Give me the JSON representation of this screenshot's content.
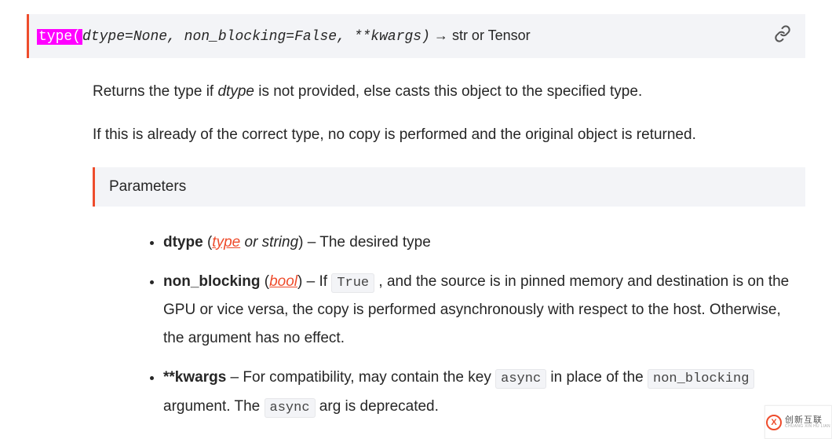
{
  "signature": {
    "method_name": "type",
    "open_paren": "(",
    "args": "dtype=None, non_blocking=False, **kwargs",
    "close_paren": ")",
    "arrow": " → ",
    "return_type": "str or Tensor"
  },
  "description": {
    "p1_a": "Returns the type if ",
    "p1_em": "dtype",
    "p1_b": " is not provided, else casts this object to the specified type.",
    "p2": "If this is already of the correct type, no copy is performed and the original object is returned."
  },
  "params_header": "Parameters",
  "params": {
    "dtype": {
      "name": "dtype",
      "open": " (",
      "type_link": "type",
      "or": " or ",
      "type2": "string",
      "close": ") – ",
      "desc": "The desired type"
    },
    "non_blocking": {
      "name": "non_blocking",
      "open": " (",
      "type_link": "bool",
      "close": ") – ",
      "pre": "If ",
      "code1": "True",
      "post": " , and the source is in pinned memory and destination is on the GPU or vice versa, the copy is performed asynchronously with respect to the host. Otherwise, the argument has no effect."
    },
    "kwargs": {
      "name": "**kwargs",
      "dash": " – ",
      "pre": "For compatibility, may contain the key ",
      "code1": "async",
      "mid": " in place of the ",
      "code2": "non_blocking",
      "post": " argument. The ",
      "code3": "async",
      "end": " arg is deprecated."
    }
  },
  "watermark": {
    "logo_letter": "X",
    "main": "创新互联",
    "sub": "CHUANG XIN HU LIAN"
  }
}
